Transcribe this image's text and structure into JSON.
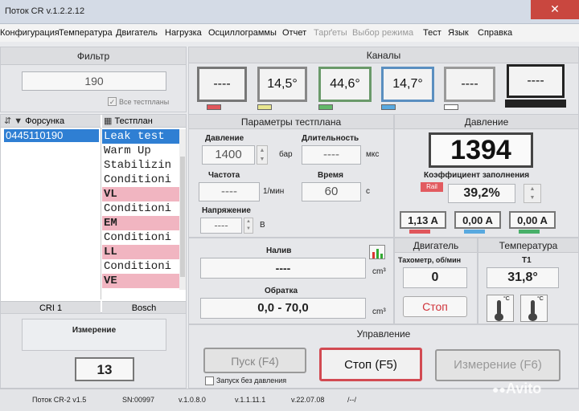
{
  "window": {
    "title": "Поток CR v.1.2.2.12",
    "close_glyph": "✕"
  },
  "menu": [
    {
      "label": "Конфигурация",
      "enabled": true
    },
    {
      "label": "Температура",
      "enabled": true
    },
    {
      "label": "Двигатель",
      "enabled": true
    },
    {
      "label": "Нагрузка",
      "enabled": true
    },
    {
      "label": "Осциллограммы",
      "enabled": true
    },
    {
      "label": "Отчет",
      "enabled": true
    },
    {
      "label": "Тарґеты",
      "enabled": false
    },
    {
      "label": "Выбор режима",
      "enabled": false
    },
    {
      "label": "Тест",
      "enabled": true
    },
    {
      "label": "Язык",
      "enabled": true
    },
    {
      "label": "Справка",
      "enabled": true
    }
  ],
  "filter": {
    "title": "Фильтр",
    "value": "190",
    "all_testplans_label": "Все тестпланы",
    "all_testplans_checked": true
  },
  "injector": {
    "header": "Форсунка",
    "selected": "0445110190",
    "footer": "CRI 1"
  },
  "testplan": {
    "header": "Тестплан",
    "footer": "Bosch",
    "items": [
      {
        "label": "Leak test",
        "selected": true,
        "highlight": false
      },
      {
        "label": "Warm Up",
        "selected": false,
        "highlight": false
      },
      {
        "label": "Stabilizin",
        "selected": false,
        "highlight": false
      },
      {
        "label": "Conditioni",
        "selected": false,
        "highlight": false
      },
      {
        "label": "VL",
        "selected": false,
        "highlight": true
      },
      {
        "label": "Conditioni",
        "selected": false,
        "highlight": false
      },
      {
        "label": "EM",
        "selected": false,
        "highlight": true
      },
      {
        "label": "Conditioni",
        "selected": false,
        "highlight": false
      },
      {
        "label": "LL",
        "selected": false,
        "highlight": true
      },
      {
        "label": "Conditioni",
        "selected": false,
        "highlight": false
      },
      {
        "label": "VE",
        "selected": false,
        "highlight": true
      }
    ]
  },
  "measurement": {
    "label": "Измерение",
    "value": "13"
  },
  "channels": {
    "title": "Каналы",
    "items": [
      {
        "value": "----",
        "color": "#e0565b"
      },
      {
        "value": "14,5°",
        "color": "#e8e58f"
      },
      {
        "value": "44,6°",
        "color": "#63b86a"
      },
      {
        "value": "14,7°",
        "color": "#58a9e0"
      },
      {
        "value": "----",
        "color": "#ffffff"
      },
      {
        "value": "----",
        "color": "#222222"
      }
    ]
  },
  "params": {
    "title": "Параметры тестплана",
    "pressure": {
      "label": "Давление",
      "value": "1400",
      "unit": "бар"
    },
    "duration": {
      "label": "Длительность",
      "value": "----",
      "unit": "мкс"
    },
    "frequency": {
      "label": "Частота",
      "value": "----",
      "unit": "1/мин"
    },
    "time": {
      "label": "Время",
      "value": "60",
      "unit": "с"
    },
    "voltage": {
      "label": "Напряжение",
      "value": "----",
      "unit": "В"
    }
  },
  "flow": {
    "delivery": {
      "label": "Налив",
      "value": "----",
      "unit": "cm³"
    },
    "backflow": {
      "label": "Обратка",
      "value": "0,0 - 70,0",
      "unit": "cm³"
    }
  },
  "pressure_panel": {
    "title": "Давление",
    "value": "1394",
    "duty_label": "Коэффициент заполнения",
    "rail_badge": "Rail",
    "duty_value": "39,2%",
    "currents": [
      {
        "value": "1,13 A",
        "color": "#e0565b"
      },
      {
        "value": "0,00 A",
        "color": "#58a9e0"
      },
      {
        "value": "0,00 A",
        "color": "#48b06a"
      }
    ]
  },
  "engine": {
    "title": "Двигатель",
    "tach_label": "Тахометр, об/мин",
    "value": "0",
    "stop": "Стоп"
  },
  "temperature": {
    "title": "Температура",
    "t1_label": "T1",
    "value": "31,8°",
    "thermo_unit": "°C"
  },
  "control": {
    "title": "Управление",
    "start": "Пуск (F4)",
    "no_pressure_label": "Запуск без давления",
    "stop": "Стоп (F5)",
    "measure": "Измерение (F6)"
  },
  "statusbar": {
    "device": "Поток CR-2 v1.5",
    "serial": "SN:00997",
    "v1": "v.1.0.8.0",
    "v2": "v.1.1.11.1",
    "v3": "v.22.07.08",
    "v4": "/--/"
  },
  "watermark": "Avito"
}
